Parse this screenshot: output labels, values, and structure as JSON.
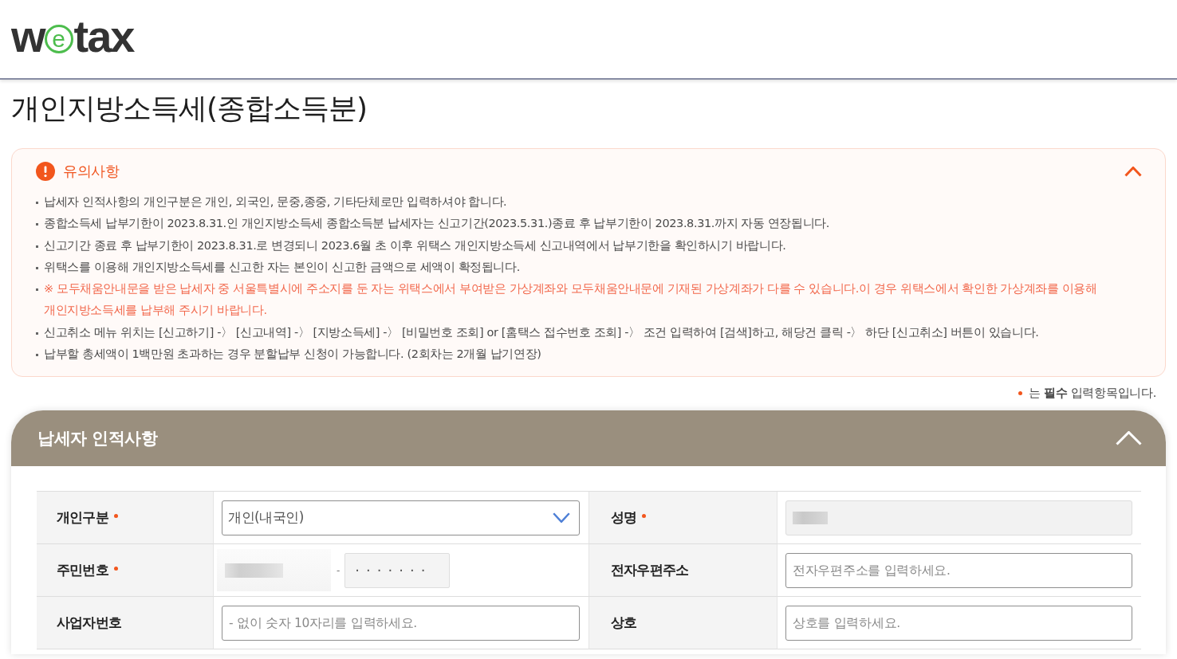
{
  "header": {
    "logo": [
      {
        "text": "w",
        "circled": false
      },
      {
        "text": "e",
        "circled": true
      },
      {
        "text": "tax",
        "circled": false
      }
    ]
  },
  "page_title": "개인지방소득세(종합소득분)",
  "notice": {
    "title": "유의사항",
    "expanded": true,
    "items": [
      {
        "text": "납세자 인적사항의 개인구분은 개인, 외국인, 문중,종중, 기타단체로만 입력하셔야 합니다.",
        "highlighted": false
      },
      {
        "text": "종합소득세 납부기한이 2023.8.31.인 개인지방소득세 종합소득분 납세자는 신고기간(2023.5.31.)종료 후 납부기한이 2023.8.31.까지 자동 연장됩니다.",
        "highlighted": false
      },
      {
        "text": "신고기간 종료 후 납부기한이 2023.8.31.로 변경되니 2023.6월 초 이후 위택스 개인지방소득세 신고내역에서 납부기한을 확인하시기 바랍니다.",
        "highlighted": false
      },
      {
        "text": "위택스를 이용해 개인지방소득세를 신고한 자는 본인이 신고한 금액으로 세액이 확정됩니다.",
        "highlighted": false
      },
      {
        "text": "※ 모두채움안내문을 받은 납세자 중 서울특별시에 주소지를 둔 자는 위택스에서 부여받은 가상계좌와 모두채움안내문에 기재된 가상계좌가 다를 수 있습니다.이 경우 위택스에서 확인한 가상계좌를 이용해 개인지방소득세를 납부해 주시기 바랍니다.",
        "highlighted": true
      },
      {
        "text": "신고취소 메뉴 위치는 [신고하기] -〉 [신고내역] -〉 [지방소득세] -〉 [비밀번호 조회] or [홈택스 접수번호 조회] -〉 조건 입력하여 [검색]하고, 해당건 클릭 -〉 하단 [신고취소] 버튼이 있습니다.",
        "highlighted": false
      },
      {
        "text": "납부할 총세액이 1백만원 초과하는 경우 분할납부 신청이 가능합니다. (2회차는 2개월 납기연장)",
        "highlighted": false
      }
    ]
  },
  "required_note": "는 **필수** 입력항목입니다.",
  "section": {
    "title": "납세자 인적사항",
    "expanded": true,
    "rows": [
      {
        "items": [
          {
            "label": "개인구분",
            "required": true,
            "field": {
              "kind": "select",
              "value": "개인(내국인)"
            }
          },
          {
            "label": "성명",
            "required": true,
            "field": {
              "kind": "redacted",
              "disabled": true
            }
          }
        ]
      },
      {
        "items": [
          {
            "label": "주민번호",
            "required": true,
            "field": {
              "kind": "resident_number",
              "separator": "-",
              "masked_value": "·······",
              "disabled": true
            }
          },
          {
            "label": "전자우편주소",
            "required": false,
            "field": {
              "kind": "input",
              "placeholder": "전자우편주소를 입력하세요."
            }
          }
        ]
      },
      {
        "items": [
          {
            "label": "사업자번호",
            "required": false,
            "field": {
              "kind": "input",
              "placeholder": "- 없이 숫자 10자리를 입력하세요."
            }
          },
          {
            "label": "상호",
            "required": false,
            "field": {
              "kind": "input",
              "placeholder": "상호를 입력하세요."
            }
          }
        ]
      }
    ]
  }
}
